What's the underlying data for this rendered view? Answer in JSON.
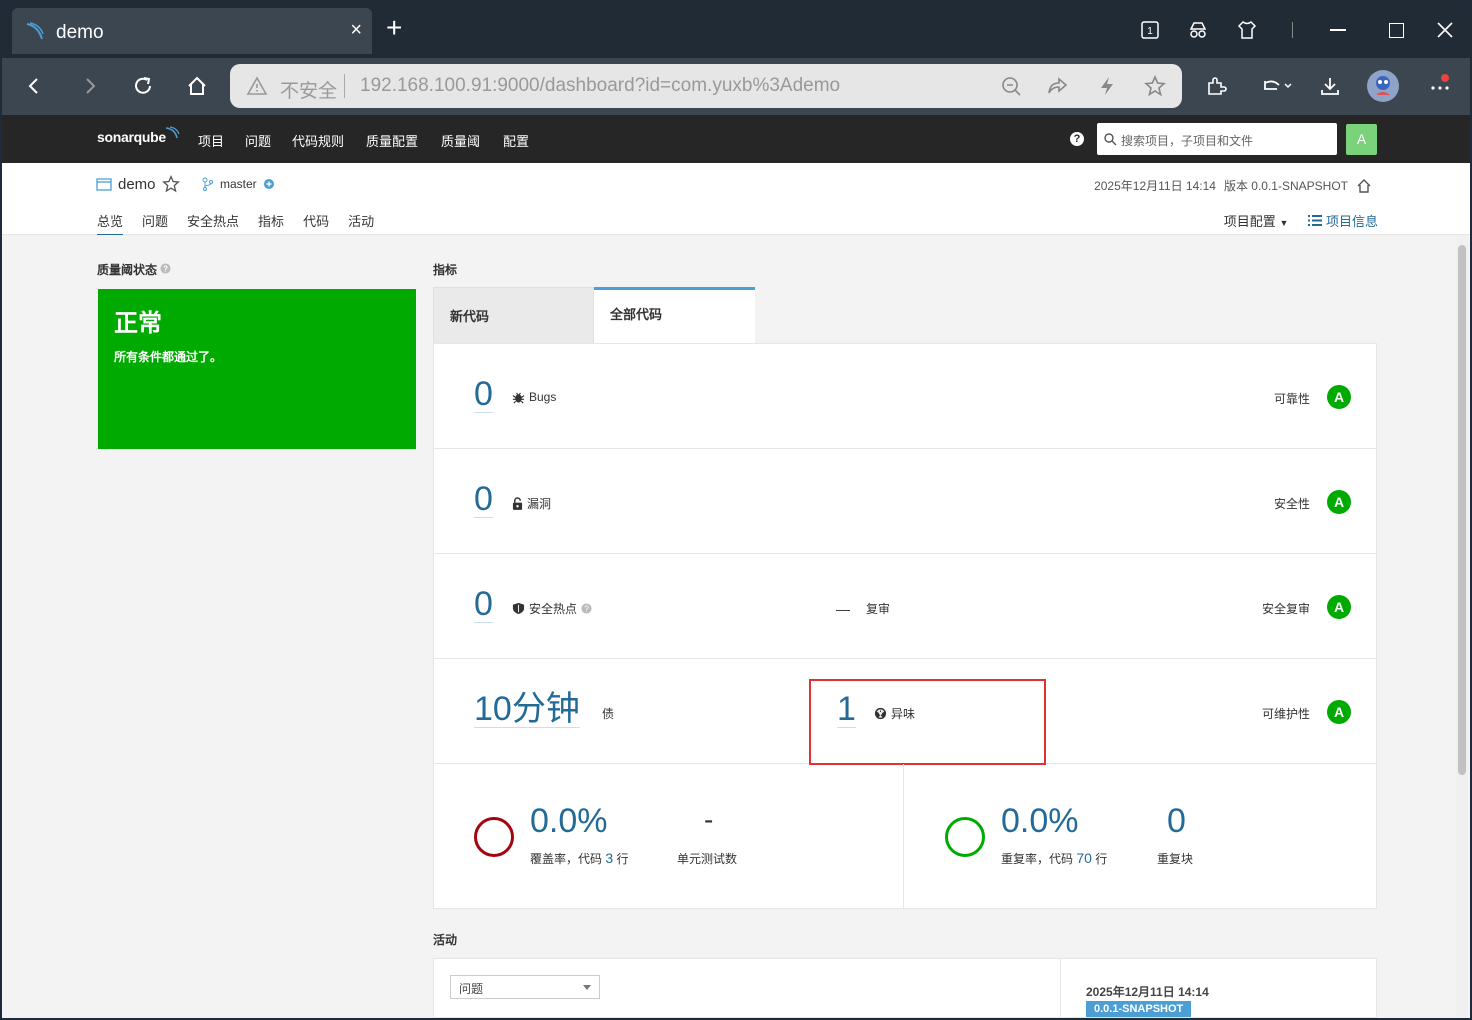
{
  "browser": {
    "tab_title": "demo",
    "tab_close": "×",
    "new_tab": "+",
    "tab_count": "1",
    "insecure_label": "不安全",
    "url": "192.168.100.91:9000/dashboard?id=com.yuxb%3Ademo",
    "icons": [
      "back-icon",
      "forward-icon",
      "reload-icon",
      "home-icon",
      "zoom-out-icon",
      "share-icon",
      "lightning-icon",
      "star-icon",
      "extensions-icon",
      "undo-icon",
      "download-icon",
      "profile-avatar",
      "menu-icon"
    ]
  },
  "sonar_nav": {
    "logo": "sonarqube",
    "items": [
      "项目",
      "问题",
      "代码规则",
      "质量配置",
      "质量阈",
      "配置"
    ],
    "help": "?",
    "search_placeholder": "搜索项目，子项目和文件",
    "user_initial": "A"
  },
  "project": {
    "name": "demo",
    "branch": "master",
    "date": "2025年12月11日 14:14",
    "version": "版本 0.0.1-SNAPSHOT",
    "tabs": [
      "总览",
      "问题",
      "安全热点",
      "指标",
      "代码",
      "活动"
    ],
    "config_label": "项目配置",
    "info_label": "项目信息"
  },
  "quality_gate": {
    "title": "质量阈状态",
    "status": "正常",
    "message": "所有条件都通过了。",
    "color": "#00aa00"
  },
  "metrics": {
    "title": "指标",
    "tabs": [
      "新代码",
      "全部代码"
    ],
    "bugs": {
      "value": "0",
      "label": "Bugs",
      "rating_label": "可靠性",
      "rating": "A"
    },
    "vulns": {
      "value": "0",
      "label": "漏洞",
      "rating_label": "安全性",
      "rating": "A"
    },
    "hotspots": {
      "value": "0",
      "label": "安全热点",
      "review_value": "—",
      "review_label": "复审",
      "rating_label": "安全复审",
      "rating": "A"
    },
    "debt": {
      "value": "10分钟",
      "label": "债",
      "smells_value": "1",
      "smells_label": "异味",
      "rating_label": "可维护性",
      "rating": "A"
    },
    "coverage": {
      "value": "0.0%",
      "label_prefix": "覆盖率，代码",
      "lines": "3",
      "label_suffix": "行",
      "tests_value": "-",
      "tests_label": "单元测试数"
    },
    "duplication": {
      "value": "0.0%",
      "label_prefix": "重复率，代码",
      "lines": "70",
      "label_suffix": "行",
      "blocks_value": "0",
      "blocks_label": "重复块"
    }
  },
  "activity": {
    "title": "活动",
    "filter": "问题",
    "date": "2025年12月11日 14:14",
    "version": "0.0.1-SNAPSHOT"
  },
  "colors": {
    "accent": "#236a97",
    "pass": "#00aa00",
    "highlight": "#e03232",
    "coverage_ring": "#a4030f"
  }
}
